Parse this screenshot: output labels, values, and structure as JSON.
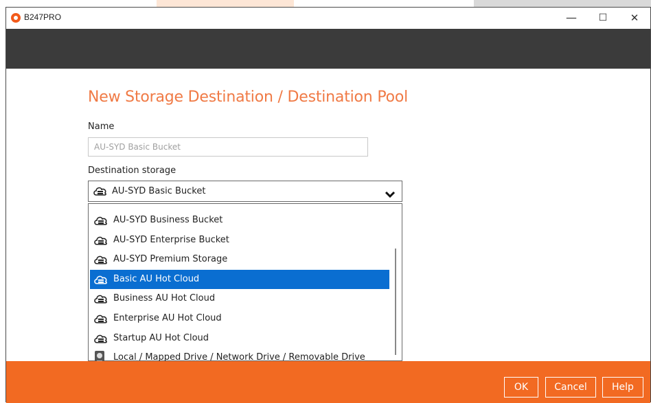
{
  "app": {
    "title": "B247PRO"
  },
  "window_controls": {
    "minimize": "—",
    "maximize": "☐",
    "close": "✕"
  },
  "form": {
    "title": "New Storage Destination / Destination Pool",
    "name_label": "Name",
    "name_placeholder": "AU-SYD Basic Bucket",
    "destination_label": "Destination storage",
    "destination_value": "AU-SYD Basic Bucket"
  },
  "dropdown": {
    "options": [
      {
        "label": "AU-SYD Business Bucket",
        "icon": "cloud-storage-icon",
        "selected": false
      },
      {
        "label": "AU-SYD Enterprise Bucket",
        "icon": "cloud-storage-icon",
        "selected": false
      },
      {
        "label": "AU-SYD Premium Storage",
        "icon": "cloud-storage-icon",
        "selected": false
      },
      {
        "label": "Basic AU Hot Cloud",
        "icon": "cloud-storage-icon",
        "selected": true
      },
      {
        "label": "Business AU Hot Cloud",
        "icon": "cloud-storage-icon",
        "selected": false
      },
      {
        "label": "Enterprise AU Hot Cloud",
        "icon": "cloud-storage-icon",
        "selected": false
      },
      {
        "label": "Startup AU Hot Cloud",
        "icon": "cloud-storage-icon",
        "selected": false
      },
      {
        "label": "Local / Mapped Drive / Network Drive / Removable Drive",
        "icon": "drive-icon",
        "selected": false
      }
    ]
  },
  "footer": {
    "ok": "OK",
    "cancel": "Cancel",
    "help": "Help"
  },
  "colors": {
    "accent": "#f26a22",
    "title": "#f07a45",
    "header": "#3b3b3b",
    "selection": "#0a6ed1"
  }
}
